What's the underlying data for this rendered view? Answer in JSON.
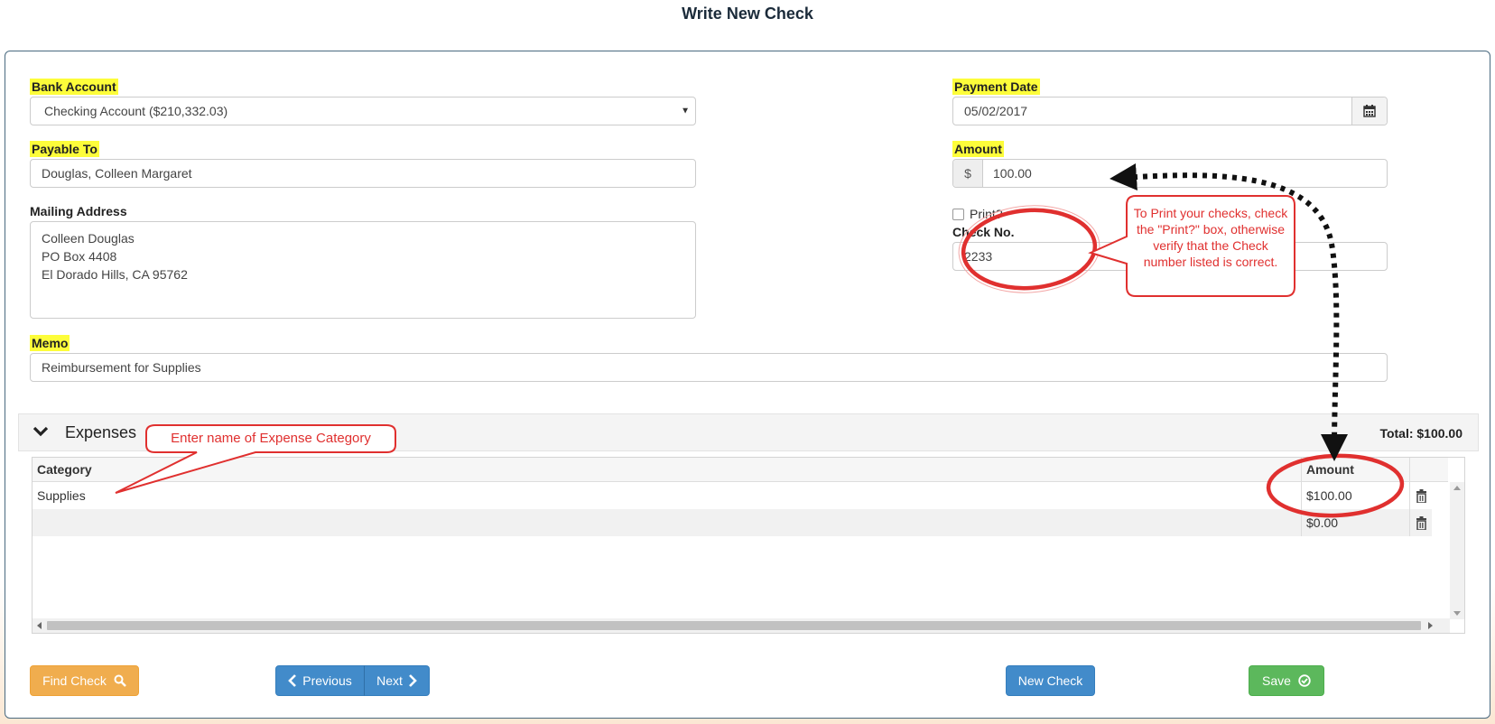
{
  "page_title": "Write New Check",
  "form": {
    "bank_account_label": "Bank Account",
    "bank_account_value": "Checking Account ($210,332.03)",
    "payment_date_label": "Payment Date",
    "payment_date_value": "05/02/2017",
    "payable_to_label": "Payable To",
    "payable_to_value": "Douglas, Colleen Margaret",
    "amount_label": "Amount",
    "amount_currency": "$",
    "amount_value": "100.00",
    "mailing_address_label": "Mailing Address",
    "mailing_address_lines": [
      "Colleen Douglas",
      "PO Box 4408",
      "El Dorado Hills, CA 95762"
    ],
    "print_label": "Print?",
    "print_checked": false,
    "check_no_label": "Check No.",
    "check_no_value": "2233",
    "memo_label": "Memo",
    "memo_value": "Reimbursement for Supplies"
  },
  "expenses": {
    "title": "Expenses",
    "total_label": "Total: $100.00",
    "columns": [
      "Category",
      "Amount"
    ],
    "rows": [
      {
        "category": "Supplies",
        "amount": "$100.00"
      },
      {
        "category": "",
        "amount": "$0.00"
      }
    ]
  },
  "annotations": {
    "print_callout": "To Print your checks, check the \"Print?\" box, otherwise verify that the Check number listed is correct.",
    "category_callout": "Enter name of Expense Category"
  },
  "buttons": {
    "find_check": "Find Check",
    "previous": "Previous",
    "next": "Next",
    "new_check": "New Check",
    "save": "Save"
  },
  "colors": {
    "highlight": "#fdfd3a",
    "annotation_red": "#e0302f",
    "btn_orange": "#f0ad4e",
    "btn_blue": "#428bca",
    "btn_green": "#5cb85c"
  },
  "icons": [
    "calendar-icon",
    "chevron-down-icon",
    "trash-icon",
    "search-icon",
    "chevron-left-icon",
    "chevron-right-icon",
    "check-circle-icon"
  ]
}
